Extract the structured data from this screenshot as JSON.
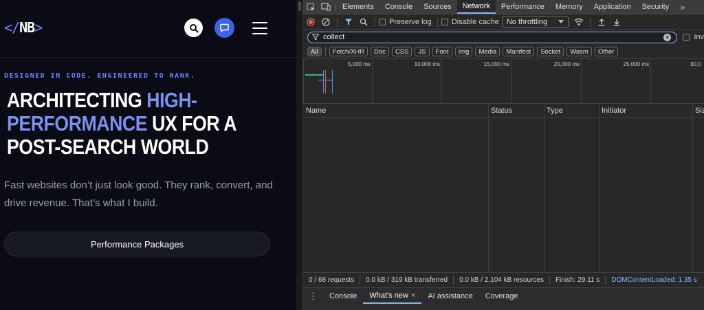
{
  "site": {
    "logo": {
      "open": "</",
      "text": "NB",
      "close": ">"
    },
    "eyebrow": "DESIGNED IN CODE. ENGINEERED TO RANK.",
    "headline": {
      "part1": "ARCHITECTING ",
      "accent1": "HIGH-PERFORMANCE",
      "part2": " UX FOR A POST-SEARCH WORLD"
    },
    "lead": "Fast websites don’t just look good. They rank, convert, and drive revenue. That’s what I build.",
    "cta_label": "Performance Packages",
    "colors": {
      "background": "#0a0b15",
      "accent": "#7b90f0",
      "chat_button": "#3f63e6"
    }
  },
  "devtools": {
    "tabs": [
      "Elements",
      "Console",
      "Sources",
      "Network",
      "Performance",
      "Memory",
      "Application",
      "Security"
    ],
    "active_tab": "Network",
    "more_tabs": "»",
    "toolbar": {
      "preserve_log": "Preserve log",
      "disable_cache": "Disable cache",
      "throttling": "No throttling"
    },
    "filter": {
      "value": "collect",
      "invert_label": "Inv"
    },
    "types": [
      "All",
      "Fetch/XHR",
      "Doc",
      "CSS",
      "JS",
      "Font",
      "Img",
      "Media",
      "Manifest",
      "Socket",
      "Wasm",
      "Other"
    ],
    "active_type": "All",
    "timeline_labels": [
      "5,000 ms",
      "10,000 ms",
      "15,000 ms",
      "20,000 ms",
      "25,000 ms",
      "30,0"
    ],
    "columns": [
      "Name",
      "Status",
      "Type",
      "Initiator",
      "Siz"
    ],
    "summary": {
      "requests": "0 / 68 requests",
      "transferred": "0.0 kB / 319 kB transferred",
      "resources": "0.0 kB / 2,104 kB resources",
      "finish": "Finish: 29.11 s",
      "dom": "DOMContentLoaded: 1.35 s"
    },
    "drawer_tabs": [
      "Console",
      "What's new",
      "AI assistance",
      "Coverage"
    ],
    "active_drawer_tab": "What's new"
  }
}
